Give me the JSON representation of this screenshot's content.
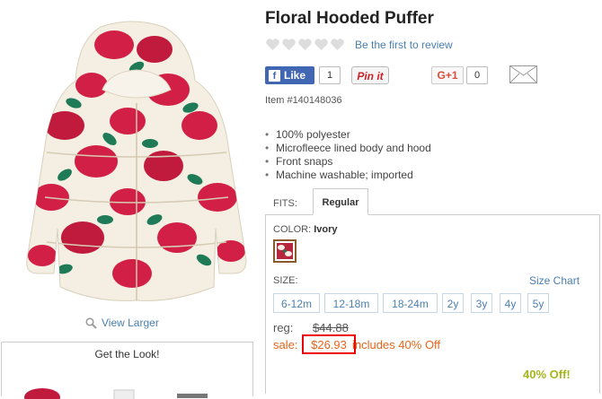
{
  "product": {
    "title": "Floral Hooded Puffer",
    "review_link": "Be the first to review",
    "rating_hearts": 5,
    "item_number": "Item #140148036",
    "view_larger": "View Larger",
    "bullets": [
      "100% polyester",
      "Microfleece lined body and hood",
      "Front snaps",
      "Machine washable; imported"
    ]
  },
  "social": {
    "fb_like_label": "Like",
    "fb_count": "1",
    "pinit_label": "Pin it",
    "gplus_label": "G+1",
    "gplus_count": "0"
  },
  "fits": {
    "label": "FITS:",
    "selected_tab": "Regular"
  },
  "color": {
    "label": "COLOR:",
    "value": "Ivory"
  },
  "size": {
    "label": "SIZE:",
    "chart_link": "Size Chart",
    "options": [
      "6-12m",
      "12-18m",
      "18-24m",
      "2y",
      "3y",
      "4y",
      "5y"
    ]
  },
  "pricing": {
    "reg_label": "reg:",
    "reg_price": "$44.88",
    "sale_label": "sale:",
    "sale_price": "$26.93",
    "sale_note": "includes 40% Off",
    "discount_badge": "40% Off!"
  },
  "get_the_look": {
    "title": "Get the Look!"
  },
  "colors": {
    "link": "#4a7fb0",
    "sale": "#e8641b",
    "highlight_box": "#e00000",
    "discount": "#a4b61b",
    "facebook": "#4267b2",
    "pinterest": "#cb2027"
  }
}
